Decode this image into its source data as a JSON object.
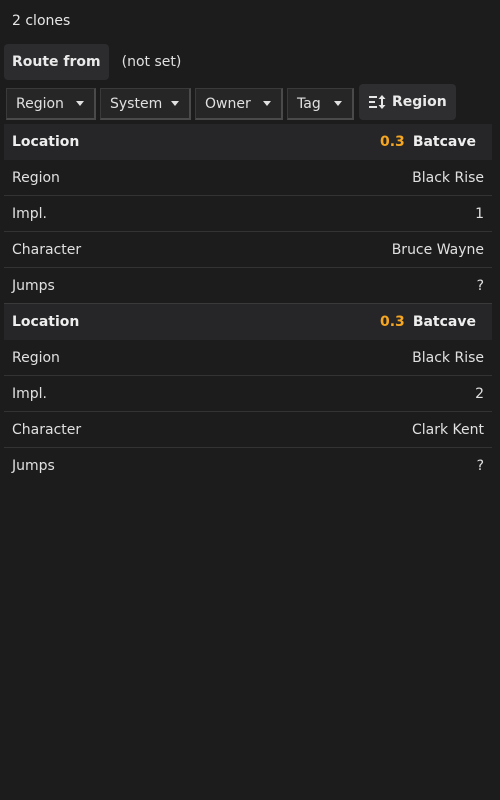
{
  "header": {
    "clone_count": "2 clones"
  },
  "route": {
    "label": "Route from",
    "value": "(not set)"
  },
  "filters": [
    {
      "label": "Region"
    },
    {
      "label": "System"
    },
    {
      "label": "Owner"
    },
    {
      "label": "Tag"
    }
  ],
  "sort": {
    "label": "Region",
    "icon": "sort-icon"
  },
  "colors": {
    "security": "#f5a623",
    "background": "#1c1c1c"
  },
  "clones": [
    {
      "location_label": "Location",
      "security": "0.3",
      "location": "Batcave",
      "rows": [
        {
          "key": "Region",
          "value": "Black Rise"
        },
        {
          "key": "Impl.",
          "value": "1"
        },
        {
          "key": "Character",
          "value": "Bruce Wayne"
        },
        {
          "key": "Jumps",
          "value": "?"
        }
      ]
    },
    {
      "location_label": "Location",
      "security": "0.3",
      "location": "Batcave",
      "rows": [
        {
          "key": "Region",
          "value": "Black Rise"
        },
        {
          "key": "Impl.",
          "value": "2"
        },
        {
          "key": "Character",
          "value": "Clark Kent"
        },
        {
          "key": "Jumps",
          "value": "?"
        }
      ]
    }
  ]
}
